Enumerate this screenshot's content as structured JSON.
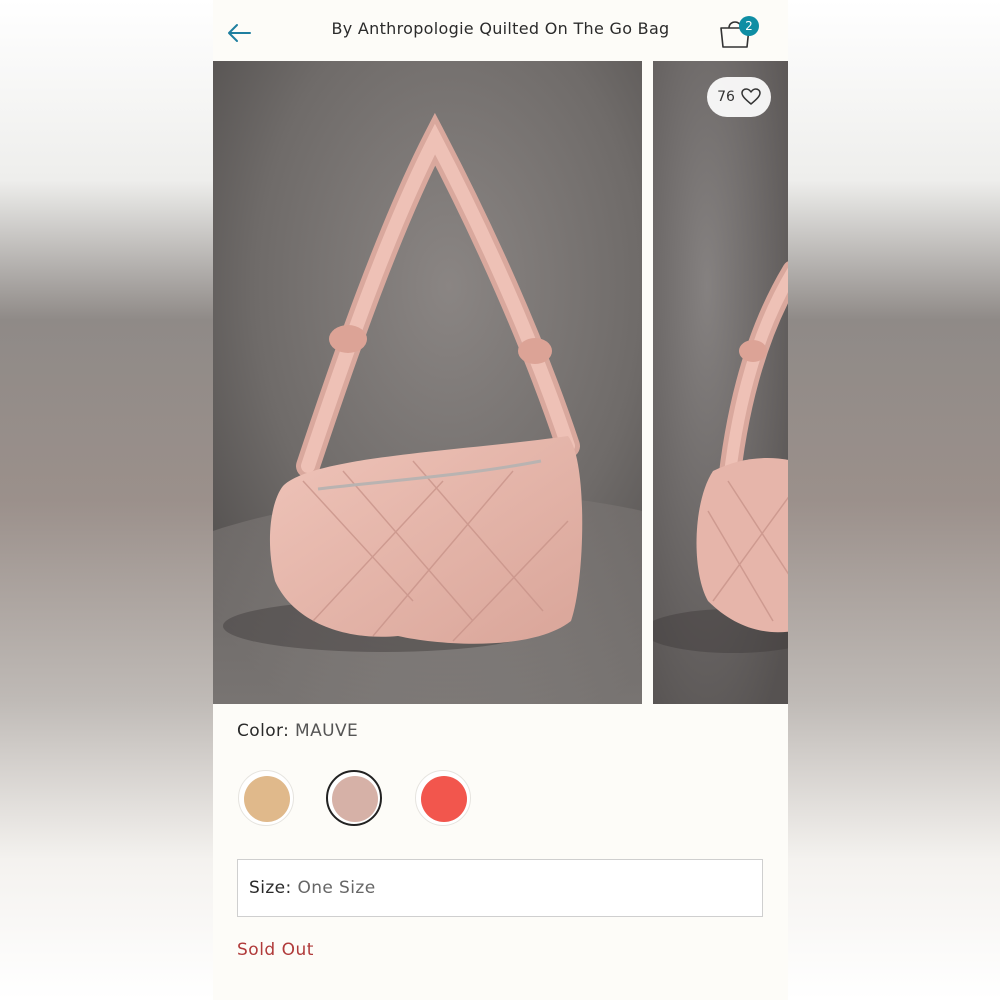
{
  "header": {
    "back_icon": "arrow-left-icon",
    "title": "By Anthropologie Quilted On The Go Bag",
    "cart_icon": "shopping-bag-icon",
    "cart_count": "2"
  },
  "gallery": {
    "favorites_count": "76",
    "heart_icon": "heart-icon"
  },
  "product": {
    "color_label": "Color:",
    "color_value": "MAUVE",
    "swatches": [
      "#e0b98b",
      "#d6b1a7",
      "#f2564d"
    ],
    "size_label": "Size:",
    "size_value": "One Size",
    "status": "Sold Out"
  },
  "colors": {
    "accent": "#0f8ea4",
    "sold_out": "#b03a3a",
    "bag": "#e8b8ad",
    "photo_background": "#6f6b69"
  }
}
